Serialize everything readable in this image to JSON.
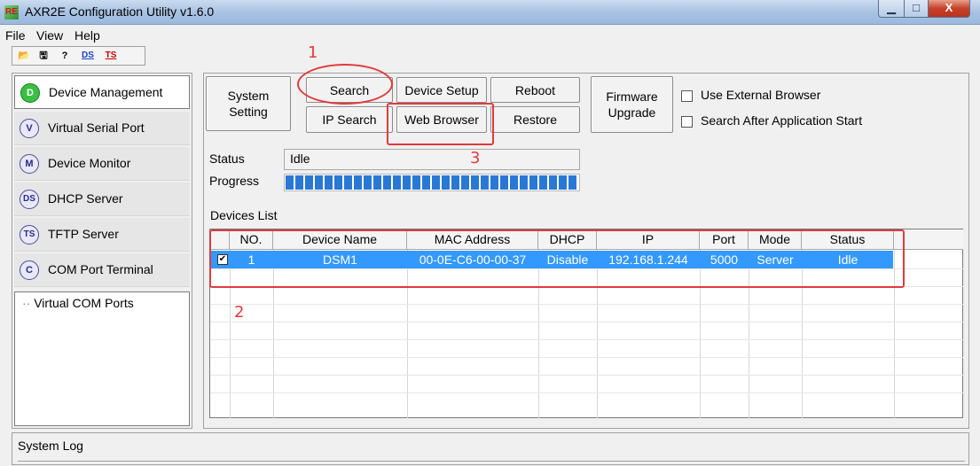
{
  "window": {
    "app_icon_text": "RE",
    "title": "AXR2E Configuration Utility v1.6.0",
    "minimize_glyph": "▁",
    "maximize_glyph": "□",
    "close_glyph": "X"
  },
  "menu": [
    "File",
    "View",
    "Help"
  ],
  "toolbar": [
    {
      "icon": "open-folder-icon",
      "glyph": "📂"
    },
    {
      "icon": "save-icon",
      "glyph": "🖫"
    },
    {
      "icon": "help-icon",
      "glyph": "?"
    },
    {
      "icon": "ds-icon",
      "glyph": "DS"
    },
    {
      "icon": "ts-icon",
      "glyph": "TS"
    }
  ],
  "sidebar": {
    "items": [
      {
        "badge": "D",
        "label": "Device Management",
        "active": true
      },
      {
        "badge": "V",
        "label": "Virtual Serial Port"
      },
      {
        "badge": "M",
        "label": "Device Monitor"
      },
      {
        "badge": "DS",
        "label": "DHCP Server"
      },
      {
        "badge": "TS",
        "label": "TFTP Server"
      },
      {
        "badge": "C",
        "label": "COM Port Terminal"
      }
    ],
    "tree_item": "Virtual COM Ports"
  },
  "buttons": {
    "system_setting": "System Setting",
    "search": "Search",
    "ip_search": "IP Search",
    "device_setup": "Device Setup",
    "web_browser": "Web Browser",
    "reboot": "Reboot",
    "restore": "Restore",
    "firmware_upgrade": "Firmware Upgrade"
  },
  "options": {
    "use_external_browser": {
      "label": "Use External Browser",
      "checked": false
    },
    "search_after_start": {
      "label": "Search After Application Start",
      "checked": false
    }
  },
  "status": {
    "status_label": "Status",
    "status_value": "Idle",
    "progress_label": "Progress",
    "progress_fraction": 1.0
  },
  "devices": {
    "label": "Devices List",
    "columns": [
      "NO.",
      "Device Name",
      "MAC Address",
      "DHCP",
      "IP",
      "Port",
      "Mode",
      "Status"
    ],
    "rows": [
      {
        "checked": true,
        "no": "1",
        "name": "DSM1",
        "mac": "00-0E-C6-00-00-37",
        "dhcp": "Disable",
        "ip": "192.168.1.244",
        "port": "5000",
        "mode": "Server",
        "status": "Idle"
      }
    ]
  },
  "annotations": {
    "one": "1",
    "two": "2",
    "three": "3",
    "color": "#e03b3b"
  },
  "system_log": {
    "label": "System Log"
  }
}
